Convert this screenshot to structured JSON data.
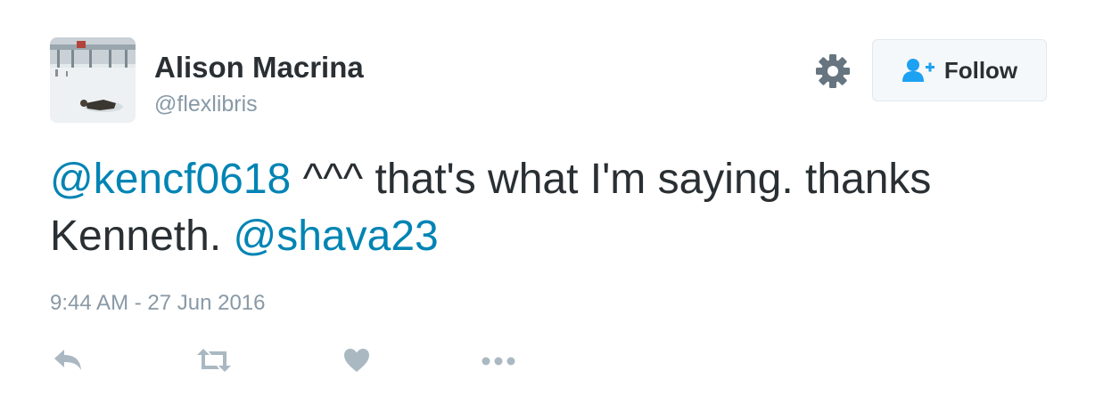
{
  "user": {
    "name": "Alison Macrina",
    "handle": "@flexlibris"
  },
  "follow_button": {
    "label": "Follow"
  },
  "tweet": {
    "mention_1": "@kencf0618",
    "text_1": " ^^^ that's what I'm saying. thanks Kenneth. ",
    "mention_2": "@shava23",
    "timestamp": "9:44 AM - 27 Jun 2016"
  },
  "icons": {
    "gear": "gear-icon",
    "follow": "add-user-icon",
    "reply": "reply-icon",
    "retweet": "retweet-icon",
    "like": "heart-icon",
    "more": "more-dots-icon"
  },
  "colors": {
    "text": "#292f33",
    "muted": "#8899a6",
    "link": "#0084b4",
    "follow_icon": "#1da1f2"
  }
}
